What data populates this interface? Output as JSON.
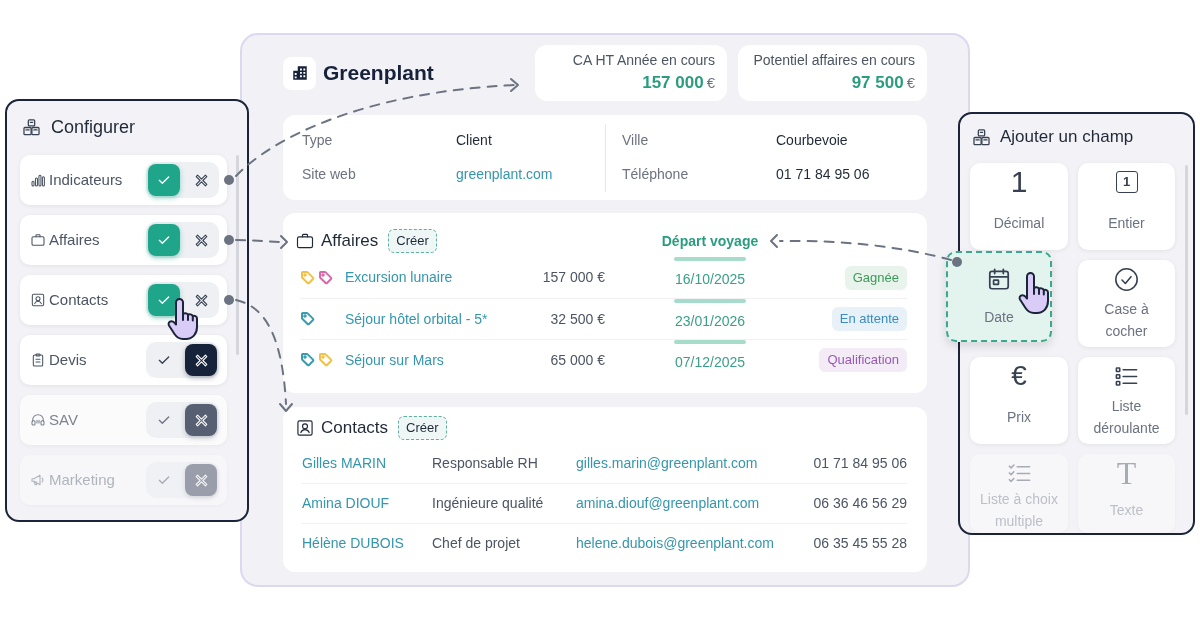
{
  "configurer": {
    "title": "Configurer",
    "items": [
      {
        "label": "Indicateurs",
        "enabled": true
      },
      {
        "label": "Affaires",
        "enabled": true
      },
      {
        "label": "Contacts",
        "enabled": true
      },
      {
        "label": "Devis",
        "enabled": false
      },
      {
        "label": "SAV",
        "enabled": false
      },
      {
        "label": "Marketing",
        "enabled": false
      }
    ]
  },
  "company": {
    "name": "Greenplant"
  },
  "kpis": [
    {
      "label": "CA HT Année en cours",
      "value": "157 000",
      "currency": "€"
    },
    {
      "label": "Potentiel affaires en cours",
      "value": "97 500",
      "currency": "€"
    }
  ],
  "info": {
    "columns": [
      {
        "fields": [
          {
            "label": "Type",
            "value": "Client",
            "kind": "text"
          },
          {
            "label": "Site web",
            "value": "greenplant.com",
            "kind": "link"
          }
        ]
      },
      {
        "fields": [
          {
            "label": "Ville",
            "value": "Courbevoie",
            "kind": "text"
          },
          {
            "label": "Téléphone",
            "value": "01 71 84 95 06",
            "kind": "text"
          }
        ]
      }
    ]
  },
  "affaires": {
    "title": "Affaires",
    "create_button": "Créer",
    "new_column": "Départ voyage",
    "rows": [
      {
        "tags": [
          {
            "color": "#f0c04a"
          },
          {
            "color": "#d46aa8"
          }
        ],
        "name": "Excursion lunaire",
        "amount": "157 000 €",
        "date": "16/10/2025",
        "status": {
          "label": "Gagnée",
          "color": "#3d9a5b"
        }
      },
      {
        "tags": [
          {
            "color": "#3a9bb0"
          }
        ],
        "name": "Séjour hôtel orbital - 5*",
        "amount": "32 500 €",
        "date": "23/01/2026",
        "status": {
          "label": "En attente",
          "color": "#3b8cc0"
        }
      },
      {
        "tags": [
          {
            "color": "#3a9bb0"
          },
          {
            "color": "#f0c04a"
          }
        ],
        "name": "Séjour sur Mars",
        "amount": "65 000 €",
        "date": "07/12/2025",
        "status": {
          "label": "Qualification",
          "color": "#9b59b6"
        }
      }
    ]
  },
  "contacts": {
    "title": "Contacts",
    "create_button": "Créer",
    "rows": [
      {
        "name": "Gilles MARIN",
        "role": "Responsable RH",
        "email": "gilles.marin@greenplant.com",
        "phone": "01 71 84 95 06"
      },
      {
        "name": "Amina DIOUF",
        "role": "Ingénieure qualité",
        "email": "amina.diouf@greenplant.com",
        "phone": "06 36 46 56 29"
      },
      {
        "name": "Hélène DUBOIS",
        "role": "Chef de projet",
        "email": "helene.dubois@greenplant.com",
        "phone": "06 35 45 55 28"
      }
    ]
  },
  "ajouter_champ": {
    "title": "Ajouter un champ",
    "fields": [
      {
        "kind": "decimal",
        "glyph": "1",
        "label": "Décimal",
        "dragged": false
      },
      {
        "kind": "integer",
        "glyph": "1",
        "label": "Entier",
        "dragged": false
      },
      {
        "kind": "date",
        "label": "Date",
        "dragged": true
      },
      {
        "kind": "checkbox",
        "label": "Case à cocher",
        "dragged": false
      },
      {
        "kind": "price",
        "glyph": "€",
        "label": "Prix",
        "dragged": false
      },
      {
        "kind": "dropdown",
        "label": "Liste déroulante",
        "dragged": false
      },
      {
        "kind": "multiselect",
        "label": "Liste à choix multiple",
        "dragged": false
      },
      {
        "kind": "text",
        "glyph": "T",
        "label": "Texte",
        "dragged": false
      }
    ]
  }
}
